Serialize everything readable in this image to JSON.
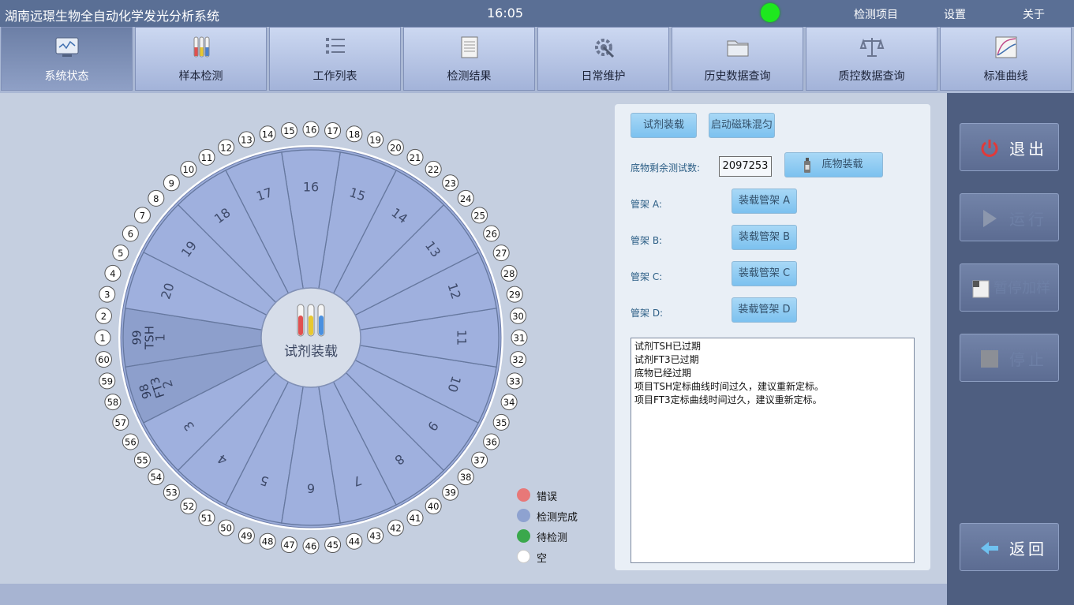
{
  "titlebar": {
    "title": "湖南远璟生物全自动化学发光分析系统",
    "time": "16:05",
    "menu": [
      "检测项目",
      "设置",
      "关于"
    ],
    "status_color": "#1ee81e"
  },
  "toolbar": {
    "tabs": [
      {
        "label": "系统状态",
        "icon": "monitor-icon",
        "active": true
      },
      {
        "label": "样本检测",
        "icon": "test-tubes-icon"
      },
      {
        "label": "工作列表",
        "icon": "list-icon"
      },
      {
        "label": "检测结果",
        "icon": "document-icon"
      },
      {
        "label": "日常维护",
        "icon": "gear-wrench-icon"
      },
      {
        "label": "历史数据查询",
        "icon": "folder-icon"
      },
      {
        "label": "质控数据查询",
        "icon": "balance-scale-icon"
      },
      {
        "label": "标准曲线",
        "icon": "curve-chart-icon"
      }
    ]
  },
  "side_buttons": [
    {
      "label": "退出",
      "icon": "power-icon",
      "enabled": true
    },
    {
      "label": "运行",
      "icon": "play-icon",
      "enabled": false
    },
    {
      "label": "暂停加样",
      "icon": "pause-sample-icon",
      "enabled": false
    },
    {
      "label": "停止",
      "icon": "stop-icon",
      "enabled": false
    },
    {
      "label": "返回",
      "icon": "back-arrow-icon",
      "enabled": true
    }
  ],
  "reagent_wheel": {
    "center_label": "试剂装载",
    "reagents": [
      {
        "position": "1",
        "count": "99",
        "name": "TSH"
      },
      {
        "position": "2",
        "count": "98",
        "name": "FT3"
      }
    ],
    "outer_positions": [
      "1",
      "2",
      "3",
      "4",
      "5",
      "6",
      "7",
      "8",
      "9",
      "10",
      "11",
      "12",
      "13",
      "14",
      "15",
      "16",
      "17",
      "18",
      "19",
      "20",
      "21",
      "22",
      "23",
      "24",
      "25",
      "26",
      "27",
      "28",
      "29",
      "30",
      "31",
      "32",
      "33",
      "34",
      "35",
      "36",
      "37",
      "38",
      "39",
      "40",
      "41",
      "42",
      "43",
      "44",
      "45",
      "46",
      "47",
      "48",
      "49",
      "50",
      "51",
      "52",
      "53",
      "54",
      "55",
      "56",
      "57",
      "58",
      "59",
      "60"
    ]
  },
  "legend": [
    {
      "label": "错误",
      "color": "#e87878"
    },
    {
      "label": "检测完成",
      "color": "#8ea2d0"
    },
    {
      "label": "待检测",
      "color": "#3aa84c"
    },
    {
      "label": "空",
      "color": "#ffffff"
    }
  ],
  "control": {
    "load_reagent": "试剂装载",
    "start_mixing": "启动磁珠混匀",
    "substrate_label": "底物剩余测试数:",
    "substrate_remaining": "2097253",
    "load_substrate": "底物装载",
    "racks": [
      {
        "label": "管架 A:",
        "button": "装载管架 A"
      },
      {
        "label": "管架 B:",
        "button": "装载管架 B"
      },
      {
        "label": "管架 C:",
        "button": "装载管架 C"
      },
      {
        "label": "管架 D:",
        "button": "装载管架 D"
      }
    ]
  },
  "messages": [
    "试剂TSH已过期",
    "试剂FT3已过期",
    "底物已经过期",
    "项目TSH定标曲线时间过久，建议重新定标。",
    "项目FT3定标曲线时间过久，建议重新定标。"
  ]
}
